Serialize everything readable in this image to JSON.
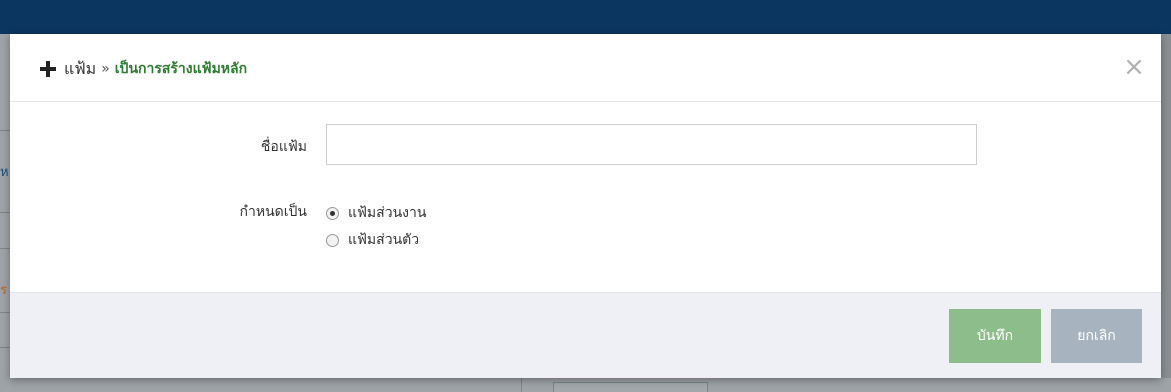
{
  "modal": {
    "title": {
      "icon": "plus-icon",
      "main": "แฟ้ม",
      "separator": "»",
      "sub": "เป็นการสร้างแฟ้มหลัก"
    },
    "close_label": "×",
    "form": {
      "name_label": "ชื่อแฟ้ม",
      "name_value": "",
      "name_placeholder": "",
      "type_label": "กำหนดเป็น",
      "type_options": [
        {
          "label": "แฟ้มส่วนงาน",
          "checked": true
        },
        {
          "label": "แฟ้มส่วนตัว",
          "checked": false
        }
      ]
    },
    "footer": {
      "save_label": "บันทึก",
      "cancel_label": "ยกเลิก"
    }
  },
  "background": {
    "left_fragment_1": "ห",
    "left_fragment_2": "ร"
  },
  "colors": {
    "topbar": "#0a3660",
    "accent_green": "#2e7d32",
    "save_button": "#8dbd8a",
    "cancel_button": "#a7b4bf",
    "footer_bg": "#eef0f5"
  }
}
